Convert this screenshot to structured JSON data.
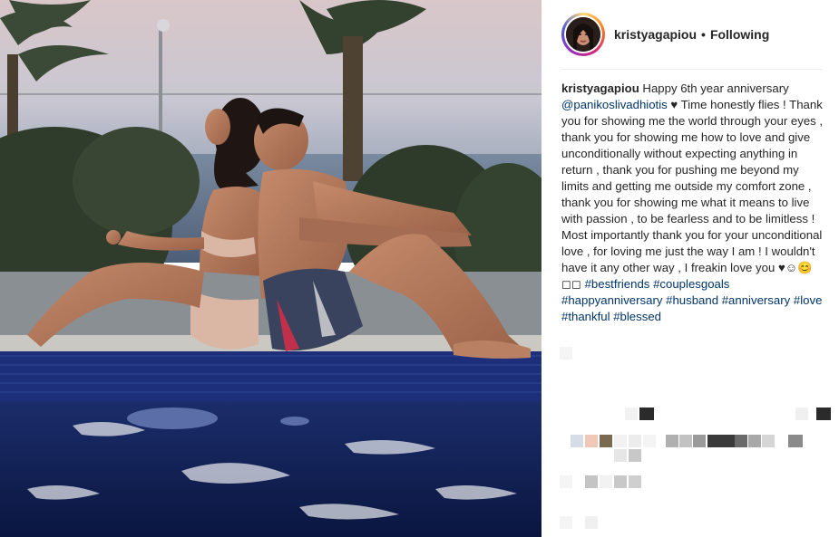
{
  "post": {
    "username": "kristyagapiou",
    "separator": "•",
    "follow_status": "Following"
  },
  "caption": {
    "username": "kristyagapiou",
    "part1": " Happy 6th year anniversary ",
    "mention": "@panikoslivadhiotis",
    "part2": " ♥ Time honestly flies ! Thank you for showing me the world through your eyes , thank you for showing me how to love and give unconditionally without expecting anything in return , thank you for pushing me beyond my limits and getting me outside my comfort zone , thank you for showing me what it means to live with passion , to be fearless and to be limitless ! Most importantly thank you for your unconditional love , for loving me just the way I am ! I wouldn't have it any other way , I freakin love you ♥☺😊◻◻ ",
    "hashtags": [
      "#bestfriends",
      "#couplesgoals",
      "#happyanniversary",
      "#husband",
      "#anniversary",
      "#love",
      "#thankful",
      "#blessed"
    ]
  },
  "photo": {
    "description_icon": "post-photo-icon"
  },
  "colors": {
    "link": "#003569",
    "text": "#262626",
    "divider": "#efefef"
  }
}
